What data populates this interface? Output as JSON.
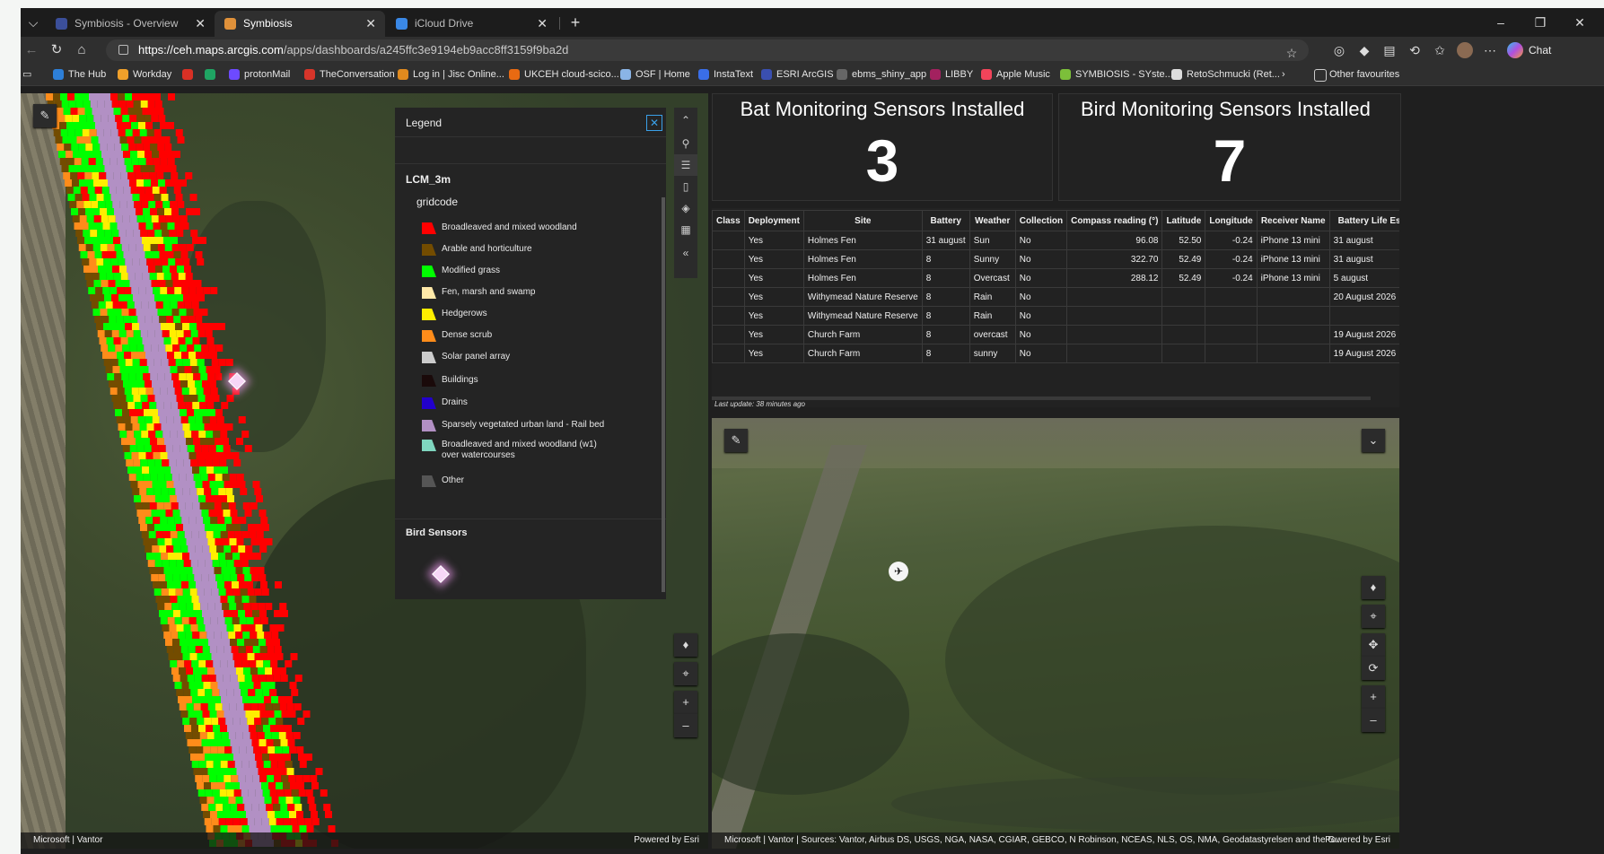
{
  "tabs": [
    {
      "label": "Symbiosis - Overview",
      "active": false
    },
    {
      "label": "Symbiosis",
      "active": true
    },
    {
      "label": "iCloud Drive",
      "active": false
    }
  ],
  "address": {
    "host": "https://ceh.maps.arcgis.com",
    "path": "/apps/dashboards/a245ffc3e9194eb9acc8ff3159f9ba2d",
    "chat_label": "Chat"
  },
  "bookmarks": [
    "The Hub",
    "Workday",
    "protonMail",
    "TheConversation",
    "Log in | Jisc Online...",
    "UKCEH cloud-scico...",
    "OSF | Home",
    "InstaText",
    "ESRI ArcGIS",
    "ebms_shiny_app",
    "LIBBY",
    "Apple Music",
    "SYMBIOSIS - SYste...",
    "RetoSchmucki (Ret...",
    "Other favourites"
  ],
  "legend": {
    "title": "Legend",
    "layer": "LCM_3m",
    "field": "gridcode",
    "items": [
      {
        "label": "Broadleaved  and mixed woodland",
        "color": "#ff0000"
      },
      {
        "label": "Arable and horticulture",
        "color": "#734c00"
      },
      {
        "label": "Modified grass",
        "color": "#00ff00"
      },
      {
        "label": "Fen, marsh and swamp",
        "color": "#ffe9a8"
      },
      {
        "label": "Hedgerows",
        "color": "#ffee00"
      },
      {
        "label": "Dense scrub",
        "color": "#ff8c1a"
      },
      {
        "label": "Solar panel array",
        "color": "#cccccc"
      },
      {
        "label": "Buildings",
        "color": "#1a0a0a"
      },
      {
        "label": "Drains",
        "color": "#2200cc"
      },
      {
        "label": "Sparsely vegetated urban land - Rail bed",
        "color": "#b290c4"
      },
      {
        "label": "Broadleaved and mixed woodland (w1) over watercourses",
        "color": "#7fd6bf"
      },
      {
        "label": "Other",
        "color": "#555555"
      }
    ],
    "sensor_layer": "Bird Sensors"
  },
  "indicators": [
    {
      "title": "Bat Monitoring Sensors Installed",
      "value": "3"
    },
    {
      "title": "Bird Monitoring Sensors Installed",
      "value": "7"
    }
  ],
  "table": {
    "headers": [
      "Class",
      "Deployment",
      "Site",
      "Battery",
      "Weather",
      "Collection",
      "Compass reading (°)",
      "Latitude",
      "Longitude",
      "Receiver Name",
      "Battery Life Esti"
    ],
    "rows": [
      [
        "",
        "Yes",
        "Holmes Fen",
        "31 august",
        "Sun",
        "No",
        "96.08",
        "52.50",
        "-0.24",
        "iPhone 13 mini",
        "31 august"
      ],
      [
        "",
        "Yes",
        "Holmes Fen",
        "8",
        "Sunny",
        "No",
        "322.70",
        "52.49",
        "-0.24",
        "iPhone 13 mini",
        "31 august"
      ],
      [
        "",
        "Yes",
        "Holmes Fen",
        "8",
        "Overcast",
        "No",
        "288.12",
        "52.49",
        "-0.24",
        "iPhone 13 mini",
        "5 august"
      ],
      [
        "",
        "Yes",
        "Withymead Nature Reserve",
        "8",
        "Rain",
        "No",
        "",
        "",
        "",
        "",
        "20 August 2026"
      ],
      [
        "",
        "Yes",
        "Withymead Nature Reserve",
        "8",
        "Rain",
        "No",
        "",
        "",
        "",
        "",
        ""
      ],
      [
        "",
        "Yes",
        "Church Farm",
        "8",
        "overcast",
        "No",
        "",
        "",
        "",
        "",
        "19 August 2026"
      ],
      [
        "",
        "Yes",
        "Church Farm",
        "8",
        "sunny",
        "No",
        "",
        "",
        "",
        "",
        "19 August 2026"
      ]
    ],
    "last_update": "Last update: 38 minutes ago"
  },
  "left_map": {
    "attribution": "Microsoft | Vantor",
    "powered": "Powered by Esri"
  },
  "right_map": {
    "attribution": "Microsoft | Vantor | Sources: Vantor, Airbus DS, USGS, NGA, NASA, CGIAR, GEBCO, N Robinson, NCEAS, NLS, OS, NMA, Geodatastyrelsen and the G...",
    "powered": "Powered by Esri"
  }
}
